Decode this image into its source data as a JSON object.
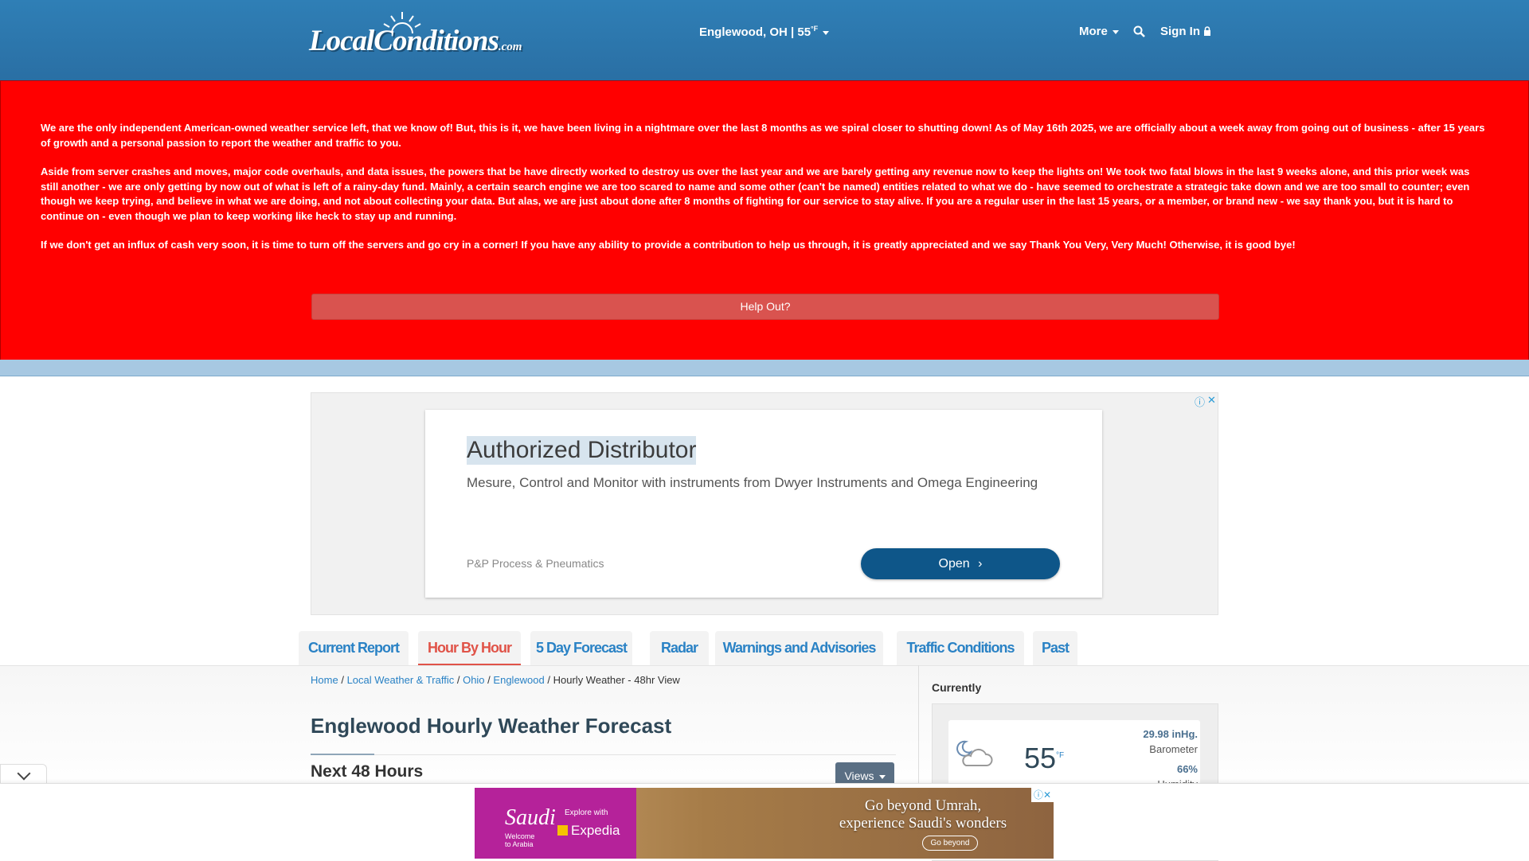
{
  "header": {
    "logo_text": "LocalConditions",
    "logo_tld": ".com",
    "location": "Englewood, OH | 55",
    "location_unit": "°F",
    "more_label": "More",
    "signin_label": "Sign In"
  },
  "banner": {
    "paragraphs": [
      "We are the only independent American-owned weather service left, that we know of! But, this is it, we have been living in a nightmare over the last 8 months as we spiral closer to shutting down! As of May 16th 2025, we are officially about a week away from going out of business - after 15 years of growth and a personal passion to report the weather and traffic to you.",
      "Aside from server crashes and moves, major code overhauls, and data issues, the powers that be have directly worked to destroy us over the last year and we are barely getting any revenue now to keep the lights on! We took two fatal blows in the last 9 weeks alone, and this prior week was still another - we are only getting by now out of what is left of a rainy-day fund. Mainly, a certain search engine we are too scared to name and some other (can't be named) entities related to what we do - have seemed to orchestrate a strategic take down and we are too small to counter; even though we keep trying, and believe in what we are doing, and not about collecting your data. But alas, we are just about done after 8 months of fighting for our service to stay alive. If you are a regular user in the last 15 years, or a member, or brand new - we say thank you, but it is hard to continue on - even though we plan to keep working like heck to stay up and running.",
      "If we don't get an influx of cash very soon, it is time to turn off the servers and go cry in a corner! If you have any ability to provide a contribution to help us through, it is greatly appreciated and we say Thank You Very, Very Much! Otherwise, it is good bye!"
    ],
    "help_button": "Help Out?"
  },
  "ad": {
    "title": "Authorized Distributor",
    "description": "Mesure, Control and Monitor with instruments from Dwyer Instruments and Omega Engineering",
    "advertiser": "P&P Process & Pneumatics",
    "cta": "Open"
  },
  "tabs": [
    {
      "label": "Current Report"
    },
    {
      "label": "Hour By Hour"
    },
    {
      "label": "5 Day Forecast"
    },
    {
      "label": "Radar"
    },
    {
      "label": "Warnings and Advisories"
    },
    {
      "label": "Traffic Conditions"
    },
    {
      "label": "Past"
    }
  ],
  "breadcrumb": {
    "home": "Home",
    "local": "Local Weather & Traffic",
    "state": "Ohio",
    "city": "Englewood",
    "current": "Hourly Weather - 48hr View",
    "sep": "/"
  },
  "main": {
    "title": "Englewood Hourly Weather Forecast",
    "subhead": "Next 48 Hours",
    "views_button": "Views"
  },
  "currently": {
    "label": "Currently",
    "temp": "55",
    "temp_unit": "°F",
    "barometer_value": "29.98 inHg.",
    "barometer_label": "Barometer",
    "humidity_value": "66%",
    "humidity_label": "Humidity",
    "icon": "partly-cloudy-night-icon"
  },
  "bottom_ad": {
    "brand": "Saudi",
    "brand_sub1": "Welcome",
    "brand_sub2": "to Arabia",
    "explore": "Explore with",
    "partner": "Expedia",
    "headline1": "Go beyond Umrah,",
    "headline2": "experience Saudi's wonders",
    "cta": "Go beyond"
  },
  "colors": {
    "header_blue": "#2f7fb6",
    "banner_red": "#ff0000",
    "link_blue": "#2a82c5",
    "active_tab": "#e05348"
  }
}
